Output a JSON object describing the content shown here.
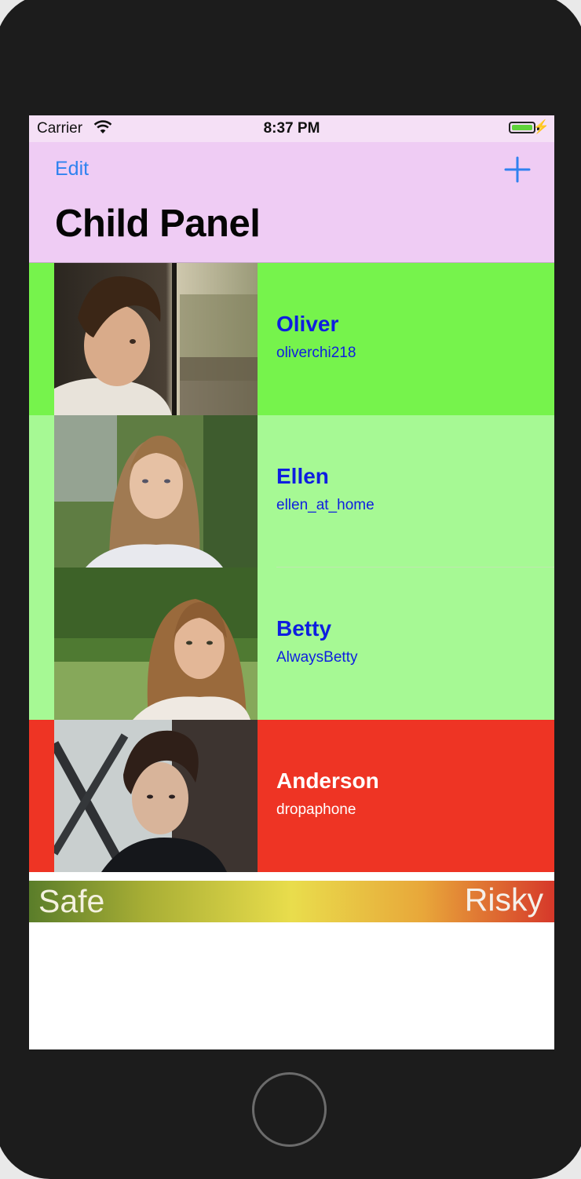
{
  "status_bar": {
    "carrier": "Carrier",
    "time": "8:37 PM",
    "battery_level": 1.0
  },
  "nav": {
    "edit_label": "Edit",
    "add_icon": "plus-icon",
    "title": "Child Panel"
  },
  "children": [
    {
      "name": "Oliver",
      "handle": "oliverchi218",
      "risk_color": "#76f34c",
      "text_color": "#0e1ee0",
      "photo": "boy-by-train-window-photo"
    },
    {
      "name": "Ellen",
      "handle": "ellen_at_home",
      "risk_color": "#a6f994",
      "text_color": "#0e1ee0",
      "photo": "girl-blonde-outdoors-photo"
    },
    {
      "name": "Betty",
      "handle": "AlwaysBetty",
      "risk_color": "#a6f994",
      "text_color": "#0e1ee0",
      "photo": "girl-in-grass-photo"
    },
    {
      "name": "Anderson",
      "handle": "dropaphone",
      "risk_color": "#ee3424",
      "text_color": "#ffffff",
      "photo": "young-man-dark-hair-photo"
    }
  ],
  "legend": {
    "safe_label": "Safe",
    "risky_label": "Risky"
  },
  "colors": {
    "nav_background": "#efccf4",
    "tint": "#2f82ef"
  }
}
